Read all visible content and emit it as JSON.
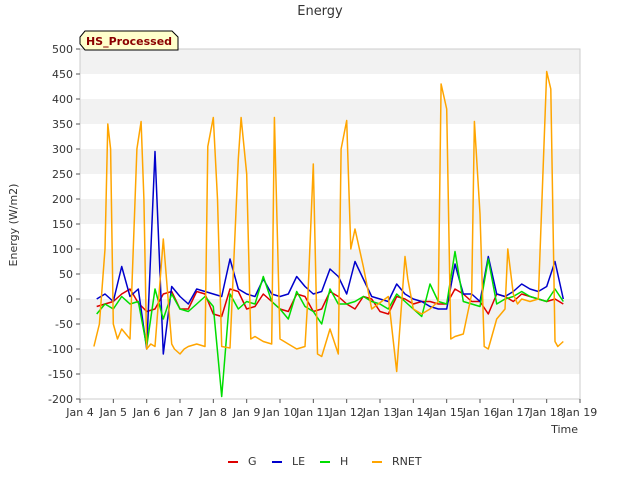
{
  "chart_data": {
    "type": "line",
    "title": "Energy",
    "xlabel": "Time",
    "ylabel": "Energy (W/m2)",
    "annotation": "HS_Processed",
    "x_range": [
      "2023-01-04",
      "2023-01-19"
    ],
    "ylim": [
      -200,
      500
    ],
    "yticks": [
      -200,
      -150,
      -100,
      -50,
      0,
      50,
      100,
      150,
      200,
      250,
      300,
      350,
      400,
      450,
      500
    ],
    "xtick_labels": [
      "Jan 4",
      "Jan 5",
      "Jan 6",
      "Jan 7",
      "Jan 8",
      "Jan 9",
      "Jan 10",
      "Jan 11",
      "Jan 12",
      "Jan 13",
      "Jan 14",
      "Jan 15",
      "Jan 16",
      "Jan 17",
      "Jan 18",
      "Jan 19"
    ],
    "grid": "horizontal bands",
    "legend_position": "bottom-center",
    "x_start_date": "2023-01-04",
    "series": [
      {
        "name": "G",
        "color": "#dd0000",
        "x": [
          "2023-01-04 12:00",
          "2023-01-04 18:00",
          "2023-01-05 00:00",
          "2023-01-05 06:00",
          "2023-01-05 12:00",
          "2023-01-05 18:00",
          "2023-01-06 00:00",
          "2023-01-06 06:00",
          "2023-01-06 12:00",
          "2023-01-06 18:00",
          "2023-01-07 00:00",
          "2023-01-07 06:00",
          "2023-01-07 12:00",
          "2023-01-07 18:00",
          "2023-01-08 00:00",
          "2023-01-08 06:00",
          "2023-01-08 12:00",
          "2023-01-08 18:00",
          "2023-01-09 00:00",
          "2023-01-09 06:00",
          "2023-01-09 12:00",
          "2023-01-09 18:00",
          "2023-01-10 00:00",
          "2023-01-10 06:00",
          "2023-01-10 12:00",
          "2023-01-10 18:00",
          "2023-01-11 00:00",
          "2023-01-11 06:00",
          "2023-01-11 12:00",
          "2023-01-11 18:00",
          "2023-01-12 00:00",
          "2023-01-12 06:00",
          "2023-01-12 12:00",
          "2023-01-12 18:00",
          "2023-01-13 00:00",
          "2023-01-13 06:00",
          "2023-01-13 12:00",
          "2023-01-13 18:00",
          "2023-01-14 00:00",
          "2023-01-14 06:00",
          "2023-01-14 12:00",
          "2023-01-14 18:00",
          "2023-01-15 00:00",
          "2023-01-15 06:00",
          "2023-01-15 12:00",
          "2023-01-15 18:00",
          "2023-01-16 00:00",
          "2023-01-16 06:00",
          "2023-01-16 12:00",
          "2023-01-16 18:00",
          "2023-01-17 00:00",
          "2023-01-17 06:00",
          "2023-01-17 12:00",
          "2023-01-17 18:00",
          "2023-01-18 00:00",
          "2023-01-18 06:00",
          "2023-01-18 12:00"
        ],
        "y": [
          -15,
          -10,
          -5,
          10,
          20,
          -8,
          -25,
          -20,
          10,
          15,
          -20,
          -20,
          15,
          10,
          -30,
          -35,
          20,
          15,
          -20,
          -15,
          10,
          -5,
          -20,
          -25,
          10,
          5,
          -25,
          -20,
          15,
          5,
          -10,
          -20,
          5,
          0,
          -25,
          -30,
          5,
          0,
          -10,
          -5,
          -5,
          -10,
          -10,
          20,
          10,
          -5,
          -5,
          -30,
          10,
          5,
          -5,
          10,
          5,
          0,
          -5,
          0,
          -10
        ]
      },
      {
        "name": "LE",
        "color": "#0000cc",
        "x": [
          "2023-01-04 12:00",
          "2023-01-04 18:00",
          "2023-01-05 00:00",
          "2023-01-05 06:00",
          "2023-01-05 12:00",
          "2023-01-05 18:00",
          "2023-01-06 00:00",
          "2023-01-06 06:00",
          "2023-01-06 12:00",
          "2023-01-06 18:00",
          "2023-01-07 00:00",
          "2023-01-07 06:00",
          "2023-01-07 12:00",
          "2023-01-07 18:00",
          "2023-01-08 00:00",
          "2023-01-08 06:00",
          "2023-01-08 12:00",
          "2023-01-08 18:00",
          "2023-01-09 00:00",
          "2023-01-09 06:00",
          "2023-01-09 12:00",
          "2023-01-09 18:00",
          "2023-01-10 00:00",
          "2023-01-10 06:00",
          "2023-01-10 12:00",
          "2023-01-10 18:00",
          "2023-01-11 00:00",
          "2023-01-11 06:00",
          "2023-01-11 12:00",
          "2023-01-11 18:00",
          "2023-01-12 00:00",
          "2023-01-12 06:00",
          "2023-01-12 12:00",
          "2023-01-12 18:00",
          "2023-01-13 00:00",
          "2023-01-13 06:00",
          "2023-01-13 12:00",
          "2023-01-13 18:00",
          "2023-01-14 00:00",
          "2023-01-14 06:00",
          "2023-01-14 12:00",
          "2023-01-14 18:00",
          "2023-01-15 00:00",
          "2023-01-15 06:00",
          "2023-01-15 12:00",
          "2023-01-15 18:00",
          "2023-01-16 00:00",
          "2023-01-16 06:00",
          "2023-01-16 12:00",
          "2023-01-16 18:00",
          "2023-01-17 00:00",
          "2023-01-17 06:00",
          "2023-01-17 12:00",
          "2023-01-17 18:00",
          "2023-01-18 00:00",
          "2023-01-18 06:00",
          "2023-01-18 12:00"
        ],
        "y": [
          0,
          10,
          -5,
          65,
          5,
          20,
          -100,
          295,
          -110,
          25,
          5,
          -10,
          20,
          15,
          10,
          5,
          80,
          20,
          10,
          5,
          40,
          10,
          5,
          10,
          45,
          25,
          10,
          15,
          60,
          45,
          10,
          75,
          40,
          5,
          0,
          -5,
          30,
          10,
          0,
          -5,
          -15,
          -20,
          -20,
          70,
          10,
          10,
          -5,
          85,
          10,
          5,
          15,
          30,
          20,
          15,
          25,
          75,
          0
        ]
      },
      {
        "name": "H",
        "color": "#00dd00",
        "x": [
          "2023-01-04 12:00",
          "2023-01-04 18:00",
          "2023-01-05 00:00",
          "2023-01-05 06:00",
          "2023-01-05 12:00",
          "2023-01-05 18:00",
          "2023-01-06 00:00",
          "2023-01-06 06:00",
          "2023-01-06 12:00",
          "2023-01-06 18:00",
          "2023-01-07 00:00",
          "2023-01-07 06:00",
          "2023-01-07 12:00",
          "2023-01-07 18:00",
          "2023-01-08 00:00",
          "2023-01-08 06:00",
          "2023-01-08 12:00",
          "2023-01-08 18:00",
          "2023-01-09 00:00",
          "2023-01-09 06:00",
          "2023-01-09 12:00",
          "2023-01-09 18:00",
          "2023-01-10 00:00",
          "2023-01-10 06:00",
          "2023-01-10 12:00",
          "2023-01-10 18:00",
          "2023-01-11 00:00",
          "2023-01-11 06:00",
          "2023-01-11 12:00",
          "2023-01-11 18:00",
          "2023-01-12 00:00",
          "2023-01-12 06:00",
          "2023-01-12 12:00",
          "2023-01-12 18:00",
          "2023-01-13 00:00",
          "2023-01-13 06:00",
          "2023-01-13 12:00",
          "2023-01-13 18:00",
          "2023-01-14 00:00",
          "2023-01-14 06:00",
          "2023-01-14 12:00",
          "2023-01-14 18:00",
          "2023-01-15 00:00",
          "2023-01-15 06:00",
          "2023-01-15 12:00",
          "2023-01-15 18:00",
          "2023-01-16 00:00",
          "2023-01-16 06:00",
          "2023-01-16 12:00",
          "2023-01-16 18:00",
          "2023-01-17 00:00",
          "2023-01-17 06:00",
          "2023-01-17 12:00",
          "2023-01-17 18:00",
          "2023-01-18 00:00",
          "2023-01-18 06:00",
          "2023-01-18 12:00"
        ],
        "y": [
          -30,
          -10,
          -20,
          5,
          -10,
          -5,
          -95,
          20,
          -40,
          10,
          -20,
          -25,
          -10,
          5,
          -15,
          -195,
          10,
          -20,
          -5,
          -10,
          45,
          -5,
          -20,
          -40,
          15,
          -15,
          -25,
          -50,
          20,
          -10,
          -10,
          -5,
          5,
          -5,
          -10,
          -20,
          10,
          -5,
          -20,
          -35,
          30,
          -5,
          -10,
          95,
          -5,
          -10,
          -15,
          80,
          -10,
          0,
          5,
          15,
          5,
          0,
          -5,
          20,
          -5
        ]
      },
      {
        "name": "RNET",
        "color": "#ffa500",
        "x": [
          "2023-01-04 10:00",
          "2023-01-04 14:00",
          "2023-01-04 18:00",
          "2023-01-04 20:00",
          "2023-01-04 22:00",
          "2023-01-05 00:00",
          "2023-01-05 03:00",
          "2023-01-05 06:00",
          "2023-01-05 12:00",
          "2023-01-05 17:00",
          "2023-01-05 20:00",
          "2023-01-05 22:00",
          "2023-01-06 00:00",
          "2023-01-06 03:00",
          "2023-01-06 06:00",
          "2023-01-06 12:00",
          "2023-01-06 18:00",
          "2023-01-06 20:00",
          "2023-01-07 00:00",
          "2023-01-07 03:00",
          "2023-01-07 06:00",
          "2023-01-07 12:00",
          "2023-01-07 18:00",
          "2023-01-07 20:00",
          "2023-01-08 00:00",
          "2023-01-08 03:00",
          "2023-01-08 06:00",
          "2023-01-08 12:00",
          "2023-01-08 18:00",
          "2023-01-08 20:00",
          "2023-01-09 00:00",
          "2023-01-09 03:00",
          "2023-01-09 06:00",
          "2023-01-09 12:00",
          "2023-01-09 18:00",
          "2023-01-09 20:00",
          "2023-01-10 00:00",
          "2023-01-10 03:00",
          "2023-01-10 06:00",
          "2023-01-10 12:00",
          "2023-01-10 18:00",
          "2023-01-10 20:00",
          "2023-01-11 00:00",
          "2023-01-11 03:00",
          "2023-01-11 06:00",
          "2023-01-11 12:00",
          "2023-01-11 18:00",
          "2023-01-11 20:00",
          "2023-01-12 00:00",
          "2023-01-12 03:00",
          "2023-01-12 06:00",
          "2023-01-12 12:00",
          "2023-01-12 18:00",
          "2023-01-13 06:00",
          "2023-01-13 12:00",
          "2023-01-13 18:00",
          "2023-01-13 20:00",
          "2023-01-14 00:00",
          "2023-01-14 06:00",
          "2023-01-14 12:00",
          "2023-01-14 18:00",
          "2023-01-14 20:00",
          "2023-01-15 00:00",
          "2023-01-15 03:00",
          "2023-01-15 06:00",
          "2023-01-15 12:00",
          "2023-01-15 18:00",
          "2023-01-15 20:00",
          "2023-01-16 00:00",
          "2023-01-16 03:00",
          "2023-01-16 06:00",
          "2023-01-16 12:00",
          "2023-01-16 18:00",
          "2023-01-16 20:00",
          "2023-01-17 00:00",
          "2023-01-17 03:00",
          "2023-01-17 06:00",
          "2023-01-17 12:00",
          "2023-01-17 18:00",
          "2023-01-18 00:00",
          "2023-01-18 03:00",
          "2023-01-18 06:00",
          "2023-01-18 08:00",
          "2023-01-18 12:00"
        ],
        "y": [
          -95,
          -50,
          100,
          350,
          300,
          -50,
          -80,
          -60,
          -80,
          300,
          355,
          200,
          -100,
          -90,
          -95,
          120,
          -90,
          -100,
          -110,
          -100,
          -95,
          -90,
          -95,
          305,
          363,
          200,
          -95,
          -98,
          280,
          363,
          250,
          -80,
          -75,
          -85,
          -90,
          363,
          -80,
          -85,
          -90,
          -100,
          -95,
          0,
          270,
          -110,
          -115,
          -60,
          -110,
          300,
          357,
          100,
          140,
          65,
          -20,
          5,
          -145,
          85,
          40,
          -20,
          -30,
          -20,
          -5,
          430,
          380,
          -80,
          -75,
          -70,
          10,
          355,
          170,
          -95,
          -100,
          -40,
          -20,
          100,
          10,
          -10,
          0,
          -5,
          0,
          455,
          420,
          -85,
          -95,
          -85
        ]
      }
    ]
  }
}
